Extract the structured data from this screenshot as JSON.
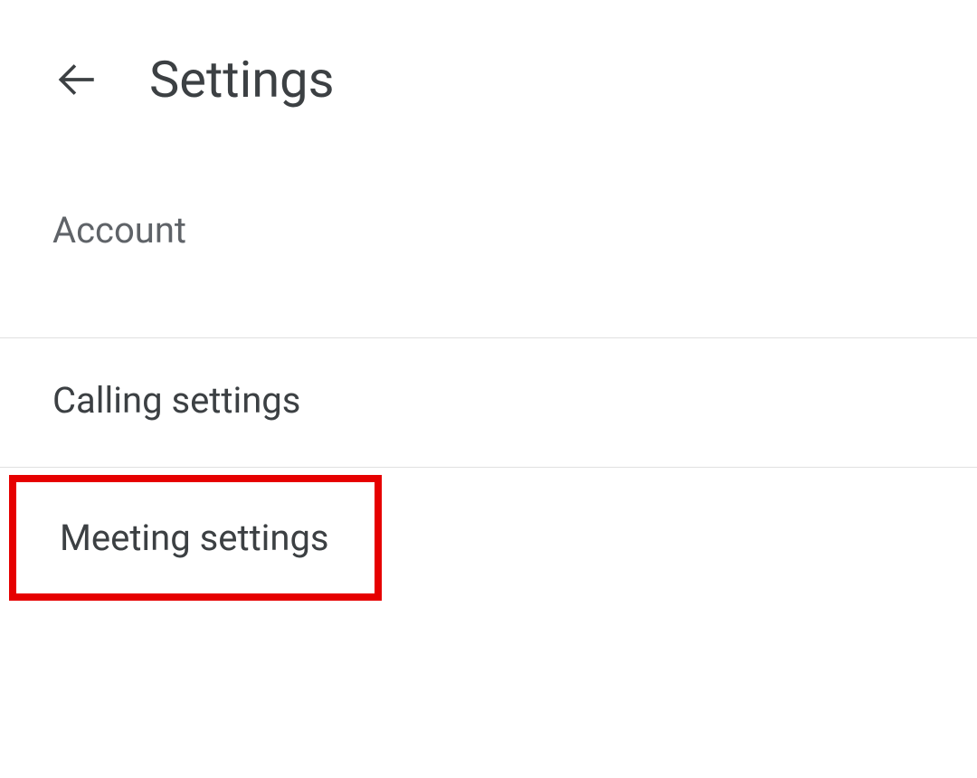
{
  "header": {
    "title": "Settings"
  },
  "sections": {
    "account": "Account",
    "calling": "Calling settings",
    "meeting": "Meeting settings"
  }
}
